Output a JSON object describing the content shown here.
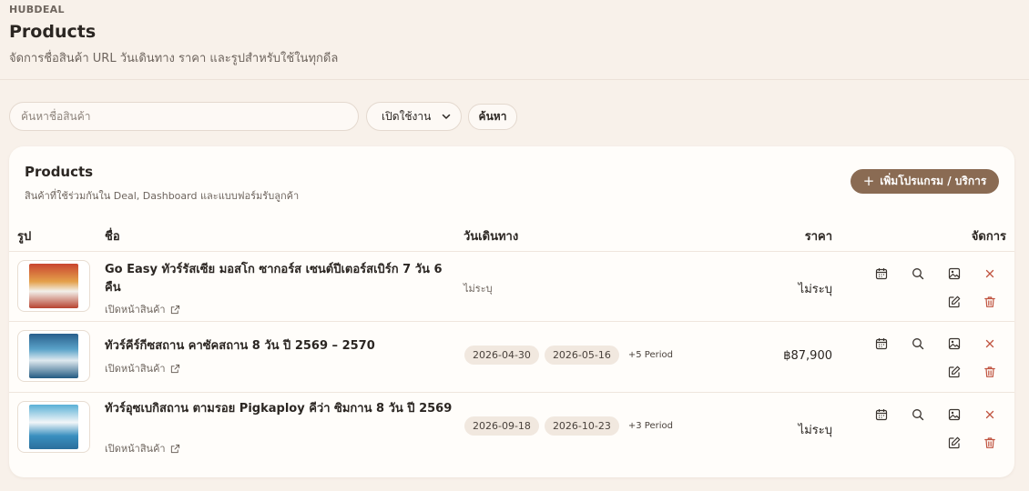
{
  "header": {
    "brand": "HUBDEAL",
    "title": "Products",
    "subtitle": "จัดการชื่อสินค้า URL วันเดินทาง ราคา และรูปสำหรับใช้ในทุกดีล"
  },
  "filters": {
    "search_placeholder": "ค้นหาชื่อสินค้า",
    "status_selected": "เปิดใช้งาน",
    "search_button": "ค้นหา"
  },
  "card": {
    "title": "Products",
    "subtitle": "สินค้าที่ใช้ร่วมกันใน Deal, Dashboard และแบบฟอร์มรับลูกค้า",
    "add_button": "เพิ่มโปรแกรม / บริการ"
  },
  "table": {
    "columns": {
      "image": "รูป",
      "name": "ชื่อ",
      "date": "วันเดินทาง",
      "price": "ราคา",
      "actions": "จัดการ"
    },
    "rows": [
      {
        "name": "Go Easy ทัวร์รัสเซีย มอสโก ซากอร์ส เซนต์ปีเตอร์สเบิร์ก 7 วัน 6 คืน",
        "link_label": "เปิดหน้าสินค้า",
        "date_text": "ไม่ระบุ",
        "price": "ไม่ระบุ"
      },
      {
        "name": "ทัวร์คีร์กีซสถาน คาซัคสถาน 8 วัน ปี 2569 – 2570",
        "link_label": "เปิดหน้าสินค้า",
        "dates": [
          "2026-04-30",
          "2026-05-16"
        ],
        "more_periods": "+5 Period",
        "price": "฿87,900"
      },
      {
        "name": "ทัวร์อุซเบกิสถาน ตามรอย Pigkaploy คีว่า ซิมกาน 8 วัน ปี 2569",
        "link_label": "เปิดหน้าสินค้า",
        "dates": [
          "2026-09-18",
          "2026-10-23"
        ],
        "more_periods": "+3 Period",
        "price": "ไม่ระบุ"
      }
    ]
  },
  "icons": {
    "calendar": "calendar-icon",
    "search": "search-icon",
    "image": "image-icon",
    "close": "close-icon",
    "edit": "edit-icon",
    "trash": "trash-icon",
    "external_link": "external-link-icon",
    "plus": "plus-icon",
    "chevron": "chevron-down-icon"
  },
  "colors": {
    "background": "#f8f1ea",
    "card": "#fffdfa",
    "accent": "#8a6b53",
    "danger": "#c0533f",
    "chip": "#f1e8df"
  }
}
